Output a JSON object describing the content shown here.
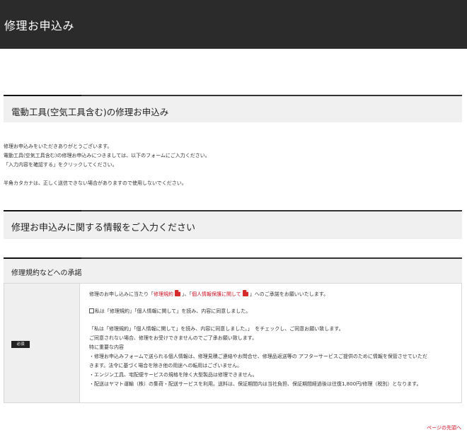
{
  "header": {
    "title": "修理お申込み"
  },
  "section1": {
    "title": "電動工具(空気工具含む)の修理お申込み"
  },
  "intro": {
    "line1": "修理お申込みをいただきありがとうございます。",
    "line2": "電動工具(空気工具含む)の修理お申込みにつきましては、以下のフォームにご入力ください。",
    "line3": "「入力内容を確認する」をクリックしてください。",
    "line4": "半角カタカナは、正しく送信できない場合がありますので使用しないでください。"
  },
  "section2": {
    "title": "修理お申込みに関する情報をご入力ください"
  },
  "section3": {
    "title": "修理規約などへの承諾"
  },
  "form": {
    "required_badge": "必須",
    "consent": {
      "intro_prefix": "修理のお申し込みに当たり「",
      "link_terms": "修理規約",
      "intro_mid": "」、「",
      "link_privacy": "個人情報保護に関して",
      "intro_suffix": "」へのご承諾をお願いいたします。",
      "checkbox_label": "私は「修理規約」「個人情報に関して」を読み、内容に同意しました。",
      "note1": "「私は「修理規約」「個人情報に関して」を読み、内容に同意しました。」　をチェックし、ご同意お願い致します。",
      "note2": "ご同意されない場合、修理をお受けできませんのでご了承お願い致します。",
      "note3": "特に重要な内容",
      "note4": "・修理お申込みフォームで送られる個人情報は、修理見積ご連絡やお問合せ、修理品返送等の アフターサービスご提供のために情報を保管させていただ",
      "note5": "きます。法令に基づく場合を除き他の用途への転用はございません。",
      "note6": "・エンジン工具、宅配便サービスの規格を除く大型製品は修理できません。",
      "note7": "・配送はヤマト運輸（株）の集荷・配送サービスを利用。送料は、保証期間内は当社負担、保証期間経過後は往復1,800円/修理（税別）となります。"
    }
  },
  "footer": {
    "page_top_link": "ページの先頭へ"
  },
  "colors": {
    "header_bg": "#2b2b2b",
    "link_red": "#cc1122",
    "section_bg": "#f0f0f0"
  }
}
